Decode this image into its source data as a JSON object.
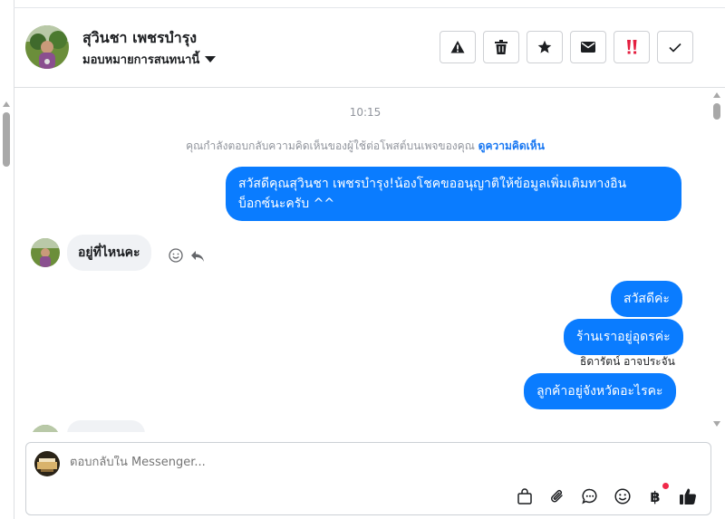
{
  "header": {
    "user_name": "สุวินชา เพชรบำรุง",
    "assign_label": "มอบหมายการสนทนานี้",
    "actions": [
      "report-icon",
      "trash-icon",
      "star-icon",
      "envelope-icon",
      "exclaim-icon",
      "check-icon"
    ]
  },
  "chat": {
    "time": "10:15",
    "notice_text": "คุณกำลังตอบกลับความคิดเห็นของผู้ใช้ต่อโพสต์บนเพจของคุณ",
    "notice_link": "ดูความคิดเห็น",
    "msg1": "สวัสดีคุณสุวินชา เพชรบำรุง!น้องโชคขออนุญาติให้ข้อมูลเพิ่มเติมทางอินบ็อกซ์นะครับ ^^",
    "msg1_line1": "สวัสดีคุณสุวินชา เพชรบำรุง!น้องโชคขออนุญาติให้ข้อมูลเพิ่มเติมทางอิน",
    "msg1_line2": "บ็อกซ์นะครับ ^^",
    "incoming1": "อยู่ที่ไหนคะ",
    "out2": "สวัสดีค่ะ",
    "out3": "ร้านเราอยู่อุดรค่ะ",
    "sender_name": "ธิดารัตน์ อาจประจัน",
    "out4": "ลูกค้าอยู่จังหวัดอะไรคะ",
    "incoming2_partial": "..."
  },
  "composer": {
    "placeholder": "ตอบกลับใน Messenger...",
    "tools": [
      "bag-icon",
      "paperclip-icon",
      "chat-bubble-icon",
      "smiley-icon",
      "baht-icon",
      "thumbs-up-icon"
    ]
  },
  "colors": {
    "outgoing": "#0a7cff",
    "incoming": "#f0f2f5",
    "link": "#1877f2",
    "notify": "#f02849",
    "exclaim": "#e41e3f"
  }
}
